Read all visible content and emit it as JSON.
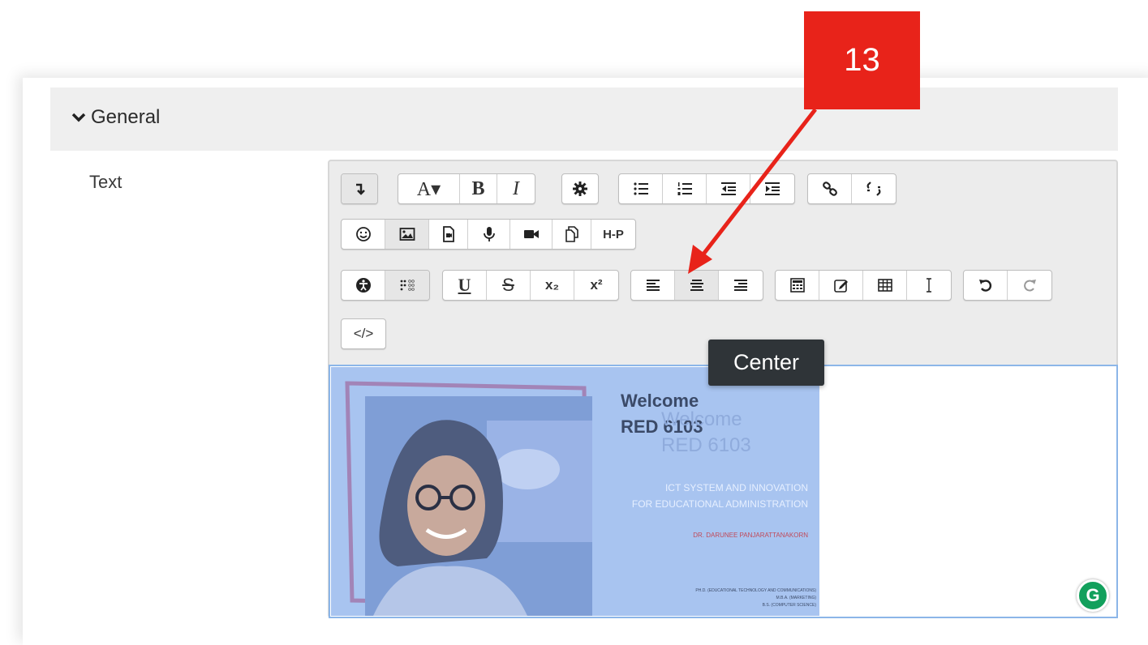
{
  "section": {
    "title": "General"
  },
  "field": {
    "label": "Text"
  },
  "toolbar": {
    "font_size_label": "A▾",
    "bold_label": "B",
    "italic_label": "I",
    "hp_label": "H-P",
    "underline_label": "U",
    "strike_label": "S",
    "subscript_label": "x₂",
    "superscript_label": "x²",
    "html_label": "</>"
  },
  "tooltip": {
    "text": "Center"
  },
  "content": {
    "welcome_line1": "Welcome",
    "welcome_line2": "RED 6103",
    "ict_line1": "ICT SYSTEM AND INNOVATION",
    "ict_line2": "FOR EDUCATIONAL ADMINISTRATION",
    "doctor_name": "DR. DARUNEE PANJARATTANAKORN",
    "degree1": "PH.D. (EDUCATIONAL TECHNOLOGY AND COMMUNICATIONS)",
    "degree2": "M.B.A. (MARKETING)",
    "degree3": "B.S. (COMPUTER SCIENCE)",
    "grammarly_label": "G"
  },
  "annotation": {
    "step_number": "13"
  },
  "colors": {
    "annotation": "#e8231a",
    "tooltip_bg": "#2f3438",
    "selection": "#8cb6e8"
  }
}
